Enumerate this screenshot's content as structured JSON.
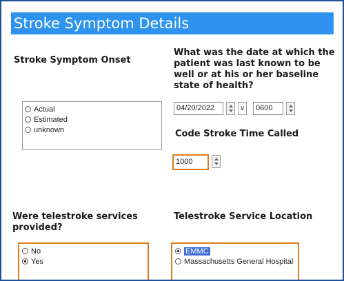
{
  "title": "Stroke Symptom Details",
  "onset": {
    "label": "Stroke Symptom Onset",
    "options": [
      "Actual",
      "Estimated",
      "unknown"
    ]
  },
  "last_known_well": {
    "question": "What was the date at which the patient was last known to be well or at his or her baseline state of health?",
    "date": "04/20/2022",
    "time": "0600",
    "dropdown_glyph": "∨"
  },
  "code_stroke": {
    "label": "Code Stroke Time Called",
    "time": "1000"
  },
  "telestroke": {
    "label": "Were telestroke services provided?",
    "options": [
      "No",
      "Yes"
    ],
    "selected": "Yes"
  },
  "telestroke_location": {
    "label": "Telestroke Service Location",
    "options": [
      "EMMC",
      "Massachusetts General Hospital"
    ],
    "selected": "EMMC"
  },
  "colors": {
    "title_bar": "#2e93ee",
    "highlight_border": "#e07b1a",
    "frame": "#1e4f9a"
  }
}
